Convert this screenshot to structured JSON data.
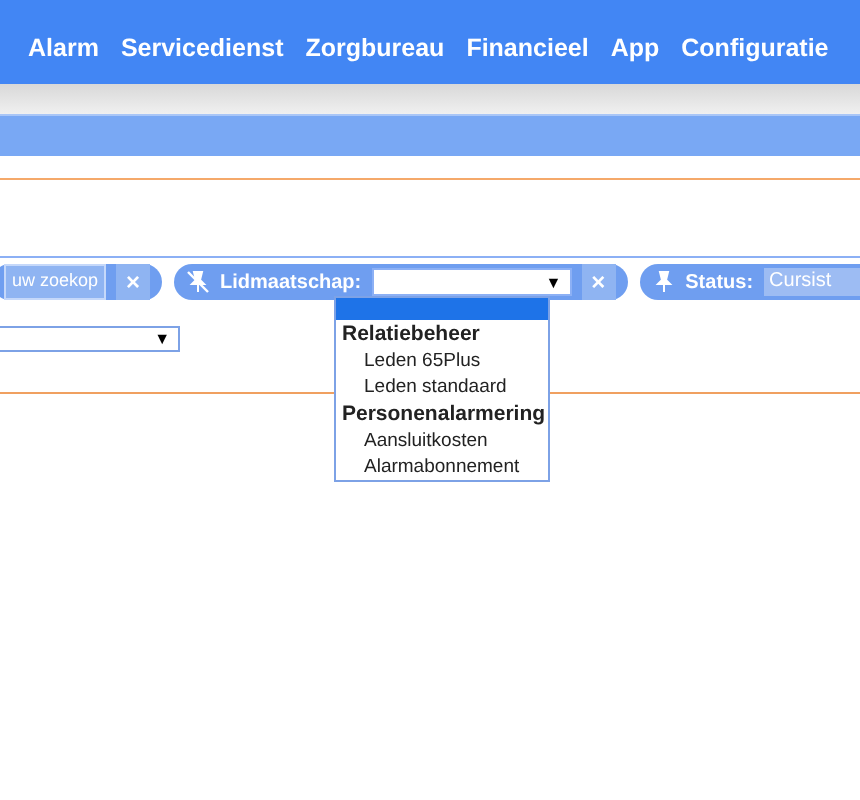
{
  "nav": {
    "items": [
      "Alarm",
      "Servicedienst",
      "Zorgbureau",
      "Financieel",
      "App",
      "Configuratie"
    ]
  },
  "filters": [
    {
      "kind": "search",
      "button": "uw zoekop",
      "remove": "×"
    },
    {
      "kind": "select",
      "pinned": false,
      "label": "Lidmaatschap:",
      "open": true,
      "remove": "×",
      "arrow": "▼"
    },
    {
      "kind": "text",
      "pinned": true,
      "label": "Status:",
      "value": "Cursist"
    }
  ],
  "dropdown": {
    "blank_selected": true,
    "groups": [
      {
        "label": "Relatiebeheer",
        "children": [
          {
            "label": "Leden 65Plus",
            "selected": false
          },
          {
            "label": "Leden standaard",
            "selected": false
          }
        ]
      },
      {
        "label": "Personenalarmering",
        "children": [
          {
            "label": "Aansluitkosten",
            "selected": false
          },
          {
            "label": "Alarmabonnement",
            "selected": false
          }
        ]
      }
    ]
  },
  "second_select": {
    "arrow": "▼"
  }
}
